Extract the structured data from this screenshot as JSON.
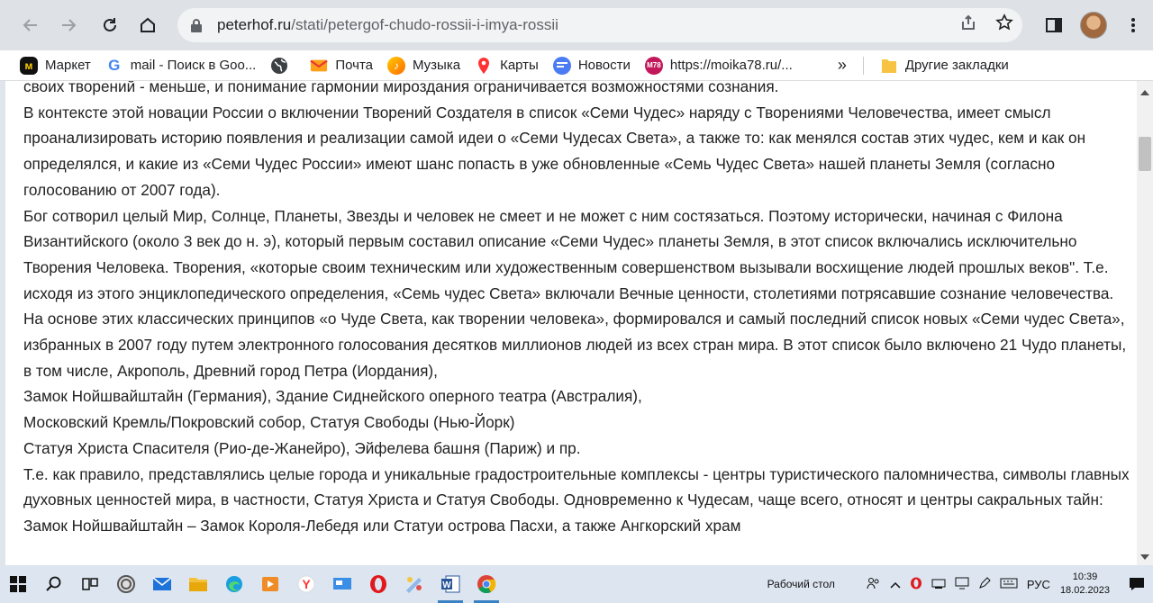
{
  "browser": {
    "url_host": "peterhof.ru",
    "url_path": "/stati/petergof-chudo-rossii-i-imya-rossii"
  },
  "bookmarks": {
    "items": [
      {
        "label": "Маркет",
        "icon": "market-icon"
      },
      {
        "label": "mail - Поиск в Goo...",
        "icon": "google-icon"
      },
      {
        "label": "",
        "icon": "globe-icon"
      },
      {
        "label": "Почта",
        "icon": "mail-icon"
      },
      {
        "label": "Музыка",
        "icon": "music-icon"
      },
      {
        "label": "Карты",
        "icon": "maps-pin-icon"
      },
      {
        "label": "Новости",
        "icon": "news-icon"
      },
      {
        "label": "https://moika78.ru/...",
        "icon": "m78-icon",
        "icon_text": "M78"
      }
    ],
    "more": "»",
    "other": "Другие закладки"
  },
  "article": {
    "paragraphs": [
      "своих творений - меньше, и понимание гармонии мироздания ограничивается возможностями сознания.",
      "В контексте этой новации России о включении Творений Создателя в список «Семи Чудес» наряду с Творениями Человечества, имеет смысл проанализировать историю появления и реализации самой идеи о «Семи Чудесах Света», а также то: как менялся состав этих чудес, кем и как он определялся, и какие из «Семи Чудес России» имеют шанс попасть в уже обновленные «Семь Чудес Света» нашей планеты Земля (согласно голосованию от 2007 года).",
      "Бог сотворил целый Мир, Солнце, Планеты, Звезды и человек не смеет и не может с ним состязаться. Поэтому исторически, начиная с Филона Византийского (около 3 век до н. э), который первым составил описание «Семи Чудес» планеты Земля, в этот список включались исключительно Творения Человека. Творения, «которые своим техническим или художественным совершенством вызывали восхищение людей прошлых веков\". Т.е. исходя из этого энциклопедического определения, «Семь чудес Света» включали Вечные ценности, столетиями потрясавшие сознание человечества.",
      "На основе этих классических принципов «о Чуде Света, как творении человека», формировался и самый последний список новых «Семи чудес Света», избранных в 2007 году путем электронного голосования десятков миллионов людей из всех стран мира. В этот список было включено 21 Чудо планеты, в том числе, Акрополь, Древний город Петра (Иордания),",
      "Замок Нойшвайштайн (Германия), Здание Сиднейского оперного театра (Австралия),",
      "Московский Кремль/Покровский собор, Статуя Свободы (Нью-Йорк)",
      "Статуя Христа Спасителя (Рио-де-Жанейро), Эйфелева башня (Париж) и пр.",
      "Т.е. как правило, представлялись целые города и уникальные градостроительные комплексы - центры туристического паломничества, символы главных духовных ценностей мира, в частности, Статуя Христа и Статуя Свободы. Одновременно к Чудесам, чаще всего, относят и центры сакральных тайн: Замок Нойшвайштайн – Замок Короля-Лебедя или Статуи острова Пасхи, а также Ангкорский храм"
    ]
  },
  "taskbar": {
    "desktop_label": "Рабочий стол",
    "language": "РУС",
    "time": "10:39",
    "date": "18.02.2023"
  }
}
